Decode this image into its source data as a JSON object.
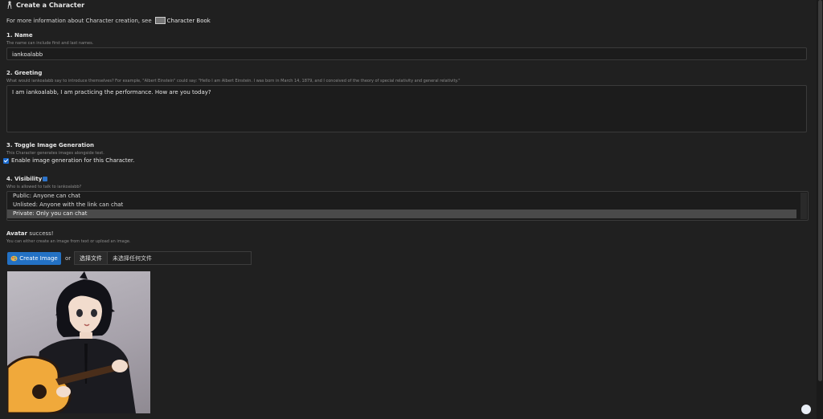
{
  "header": {
    "title": "Create a Character",
    "icon": "person-icon"
  },
  "info": {
    "text": "For more information about Character creation, see",
    "link_label": "Character Book"
  },
  "name": {
    "heading": "1. Name",
    "help": "The name can include first and last names.",
    "value": "iankoalabb"
  },
  "greeting": {
    "heading": "2. Greeting",
    "help": "What would iankoalabb say to introduce themselves? For example, \"Albert Einstein\" could say: \"Hello I am Albert Einstein. I was born in March 14, 1879, and I conceived of the theory of special relativity and general relativity.\"",
    "value": "I am iankoalabb, I am practicing the performance. How are you today?"
  },
  "image_gen": {
    "heading": "3. Toggle Image Generation",
    "help": "This Character generates images alongside text.",
    "checkbox_label": "Enable image generation for this Character.",
    "checked": true
  },
  "visibility": {
    "heading": "4. Visibility",
    "help": "Who is allowed to talk to iankoalabb?",
    "options": [
      "Public: Anyone can chat",
      "Unlisted: Anyone with the link can chat",
      "Private: Only you can chat"
    ],
    "selected": "Private: Only you can chat"
  },
  "avatar": {
    "heading": "Avatar",
    "status": "success!",
    "help": "You can either create an image from text or upload an image.",
    "create_label": "Create Image",
    "or_text": "or",
    "choose_file_label": "选择文件",
    "no_file_text": "未选择任何文件"
  },
  "colors": {
    "accent": "#2371c4",
    "background": "#202020"
  }
}
